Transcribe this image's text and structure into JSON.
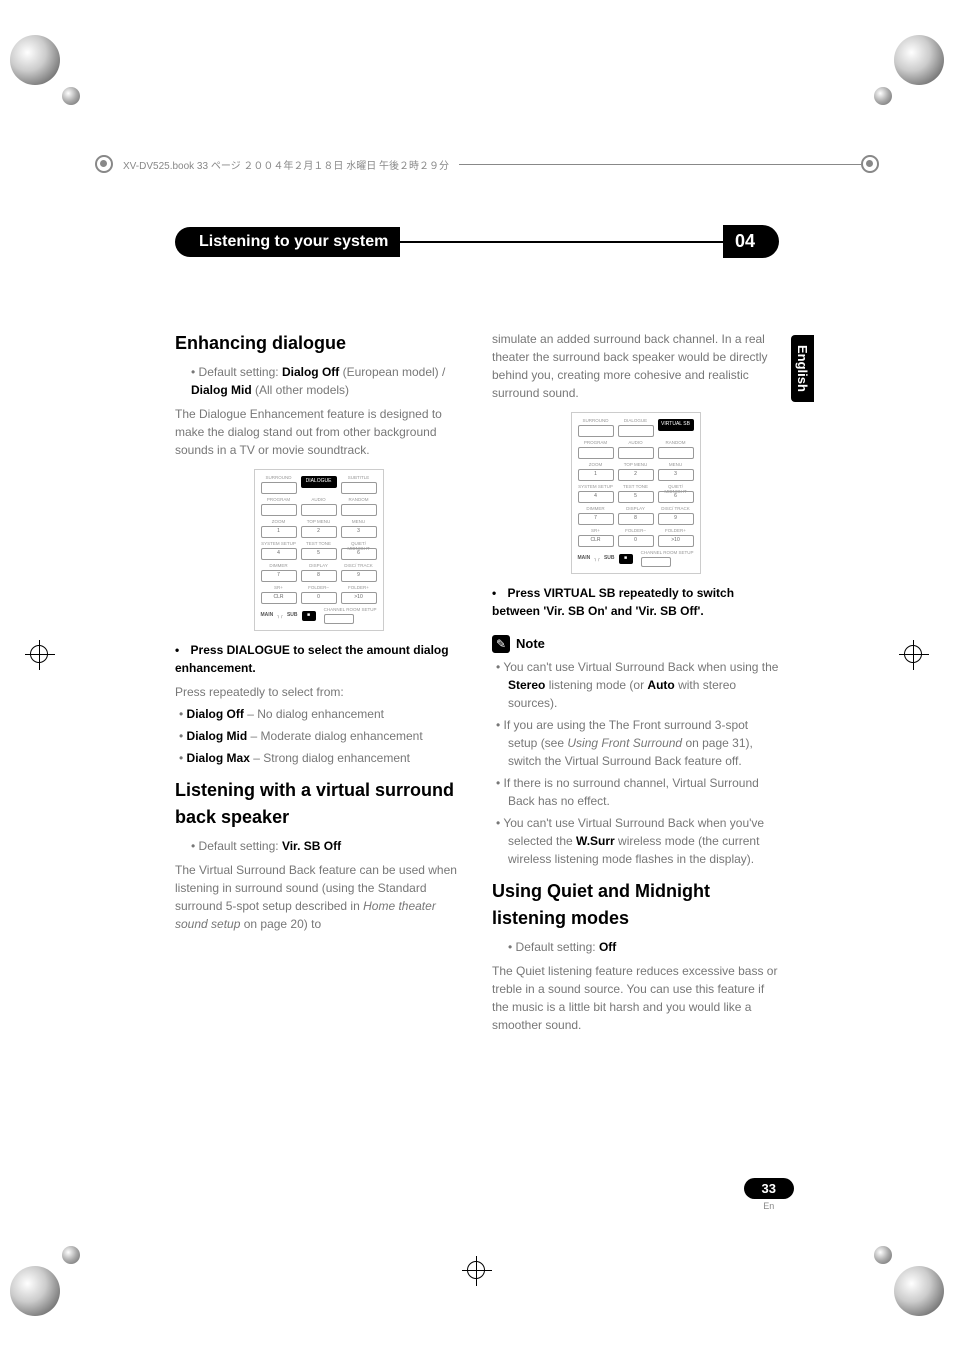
{
  "meta": {
    "header_jp": "XV-DV525.book 33 ページ ２００４年２月１８日 水曜日 午後２時２９分"
  },
  "page_header": {
    "title": "Listening to your system",
    "chapter": "04"
  },
  "lang_tab": "English",
  "page_number": "33",
  "page_sub": "En",
  "left": {
    "h1": "Enhancing dialogue",
    "default1a": "Default setting: ",
    "default1b": "Dialog Off",
    "default1c": " (European model) / ",
    "default1d": "Dialog Mid",
    "default1e": " (All other models)",
    "body1": "The Dialogue Enhancement feature is designed to make the dialog stand out from other background sounds in a TV or movie soundtrack.",
    "instruction1a": "Press DIALOGUE to select the amount dialog enhancement.",
    "body2": "Press repeatedly to select from:",
    "opt1a": "Dialog Off",
    "opt1b": " – No dialog enhancement",
    "opt2a": "Dialog Mid",
    "opt2b": " – Moderate dialog enhancement",
    "opt3a": "Dialog Max",
    "opt3b": " – Strong dialog enhancement",
    "h2": "Listening with a virtual surround back speaker",
    "default2a": "Default setting: ",
    "default2b": "Vir. SB Off",
    "body3a": "The Virtual Surround Back feature can be used when listening in surround sound (using the Standard surround 5-spot setup described in ",
    "body3b": "Home theater sound setup",
    "body3c": " on page 20) to"
  },
  "right": {
    "body1": "simulate an added surround back channel. In a real theater the surround back speaker would be directly behind you, creating more cohesive and realistic surround sound.",
    "instruction1": "Press VIRTUAL SB repeatedly to switch between 'Vir. SB On' and 'Vir. SB Off'.",
    "note_label": "Note",
    "n1a": "You can't use Virtual Surround Back when using the ",
    "n1b": "Stereo",
    "n1c": " listening mode (or ",
    "n1d": "Auto",
    "n1e": " with stereo sources).",
    "n2a": "If you are using the The Front surround 3-spot setup (see ",
    "n2b": "Using Front Surround",
    "n2c": " on page 31), switch the Virtual Surround Back feature off.",
    "n3": "If there is no surround channel, Virtual Surround Back has no effect.",
    "n4a": "You can't use Virtual Surround Back when you've selected the ",
    "n4b": "W.Surr",
    "n4c": " wireless mode (the current wireless listening mode flashes in the display).",
    "h3": "Using Quiet and Midnight listening modes",
    "default3a": "Default setting: ",
    "default3b": "Off",
    "body4": "The Quiet listening feature reduces excessive bass or treble in a sound source. You can use this feature if the music is a little bit harsh and you would like a smoother sound."
  },
  "remote": {
    "row1": [
      "SURROUND",
      "DIALOGUE",
      "SUBTITLE"
    ],
    "row2": [
      "PROGRAM",
      "",
      "RANDOM"
    ],
    "row3": [
      "ZOOM",
      "TOP MENU",
      "MENU"
    ],
    "row3b": [
      "1",
      "2",
      "3"
    ],
    "row4": [
      "SYSTEM SETUP",
      "TEST TONE",
      "QUIET/ MIDNIGHT"
    ],
    "row4b": [
      "4",
      "5",
      "6"
    ],
    "row5": [
      "DIMMER",
      "DISPLAY",
      "DISC/ TRACK"
    ],
    "row5b": [
      "7",
      "8",
      "9"
    ],
    "row6": [
      "SR+",
      "FOLDER–",
      "FOLDER+"
    ],
    "row6b": [
      "CLR",
      "0",
      ">10"
    ],
    "bottom_label": "MAIN",
    "bottom_sub": "SUB",
    "bottom_right": "CHANNEL ROOM SETUP",
    "highlight1": "DIALOGUE",
    "virtual_highlight": "VIRTUAL SB",
    "sub_highlight": "SUBTITLE"
  }
}
